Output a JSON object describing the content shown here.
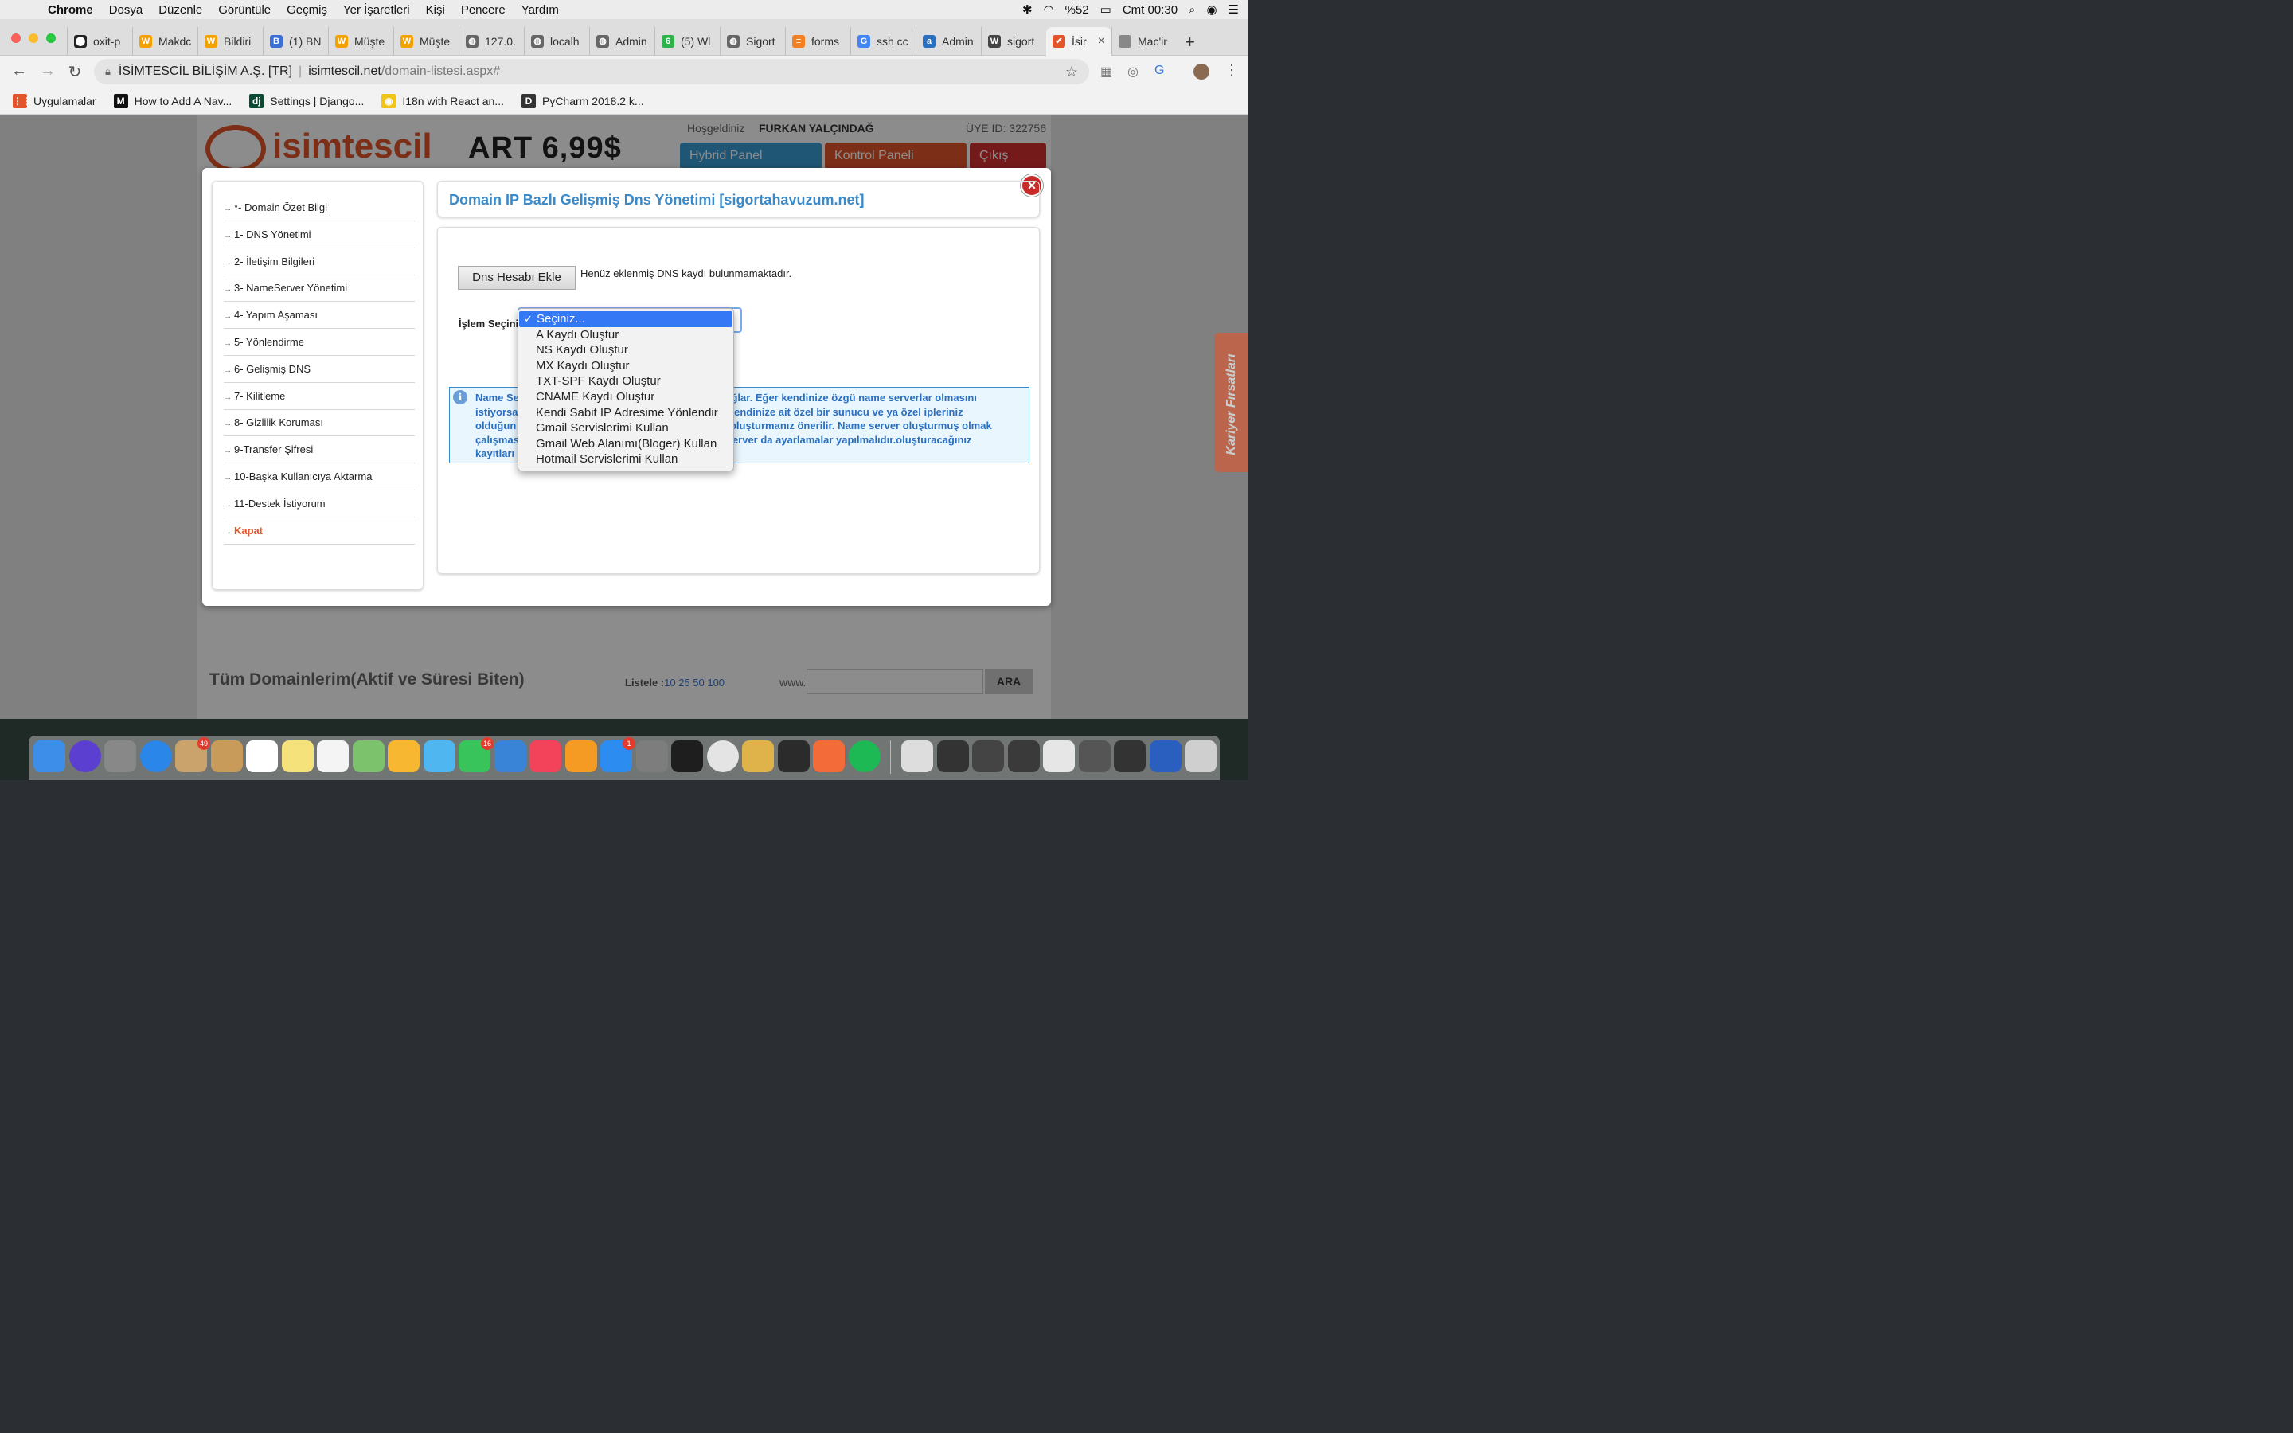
{
  "menubar": {
    "items": [
      "Chrome",
      "Dosya",
      "Düzenle",
      "Görüntüle",
      "Geçmiş",
      "Yer İşaretleri",
      "Kişi",
      "Pencere",
      "Yardım"
    ],
    "battery": "%52",
    "clock": "Cmt 00:30"
  },
  "tabs": [
    {
      "label": "oxit-p",
      "color": "#222222",
      "glyph": "⬤"
    },
    {
      "label": "Makdc",
      "color": "#f4a100",
      "glyph": "W"
    },
    {
      "label": "Bildiri",
      "color": "#f4a100",
      "glyph": "W"
    },
    {
      "label": "(1) BN",
      "color": "#3b6fd6",
      "glyph": "B"
    },
    {
      "label": "Müşte",
      "color": "#f4a100",
      "glyph": "W"
    },
    {
      "label": "Müşte",
      "color": "#f4a100",
      "glyph": "W"
    },
    {
      "label": "127.0.",
      "color": "#666666",
      "glyph": "◍"
    },
    {
      "label": "localh",
      "color": "#666666",
      "glyph": "◍"
    },
    {
      "label": "Admin",
      "color": "#666666",
      "glyph": "◍"
    },
    {
      "label": "(5) Wl",
      "color": "#2db34a",
      "glyph": "6"
    },
    {
      "label": "Sigort",
      "color": "#666666",
      "glyph": "◍"
    },
    {
      "label": "forms",
      "color": "#f48024",
      "glyph": "≡"
    },
    {
      "label": "ssh cc",
      "color": "#4285f4",
      "glyph": "G"
    },
    {
      "label": "Admin",
      "color": "#2a6fc0",
      "glyph": "a"
    },
    {
      "label": "sigort",
      "color": "#444444",
      "glyph": "W"
    },
    {
      "label": "İsir",
      "color": "#e2542a",
      "glyph": "✔",
      "active": true
    },
    {
      "label": "Mac'ir",
      "color": "#888888",
      "glyph": ""
    }
  ],
  "address": {
    "site_name": "İSİMTESCİL BİLİŞİM A.Ş. [TR]",
    "host": "isimtescil.net",
    "path": "/domain-listesi.aspx#"
  },
  "bookmarks": [
    {
      "label": "Uygulamalar",
      "glyph": "⋮⋮",
      "color": "#e2542a"
    },
    {
      "label": "How to Add A Nav...",
      "glyph": "M",
      "color": "#111111"
    },
    {
      "label": "Settings | Django...",
      "glyph": "dj",
      "color": "#0c4b33"
    },
    {
      "label": "I18n with React an...",
      "glyph": "◉",
      "color": "#f0c419"
    },
    {
      "label": "PyCharm 2018.2 k...",
      "glyph": "D",
      "color": "#333333"
    }
  ],
  "site": {
    "logo": "isimtescil",
    "promo": "ART 6,99$",
    "greeting": "Hoşgeldiniz",
    "user": "FURKAN YALÇINDAĞ",
    "member_id": "ÜYE ID: 322756",
    "header_buttons": [
      {
        "label": "Hybrid Panel",
        "color": "#3a9bd5"
      },
      {
        "label": "Kontrol Paneli",
        "color": "#e2542a"
      },
      {
        "label": "Çıkış",
        "color": "#d63031"
      }
    ],
    "all_domains": "Tüm Domainlerim(Aktif ve Süresi Biten)",
    "listele_label": "Listele :",
    "listele_values": "10 25 50 100",
    "www": "www.",
    "search_button": "ARA",
    "side_tab": "Kariyer Fırsatları"
  },
  "modal": {
    "title": "Domain IP Bazlı Gelişmiş Dns Yönetimi [sigortahavuzum.net]",
    "menu": [
      "*- Domain Özet Bilgi",
      "1- DNS Yönetimi",
      "2- İletişim Bilgileri",
      "3- NameServer Yönetimi",
      "4- Yapım Aşaması",
      "5- Yönlendirme",
      "6- Gelişmiş DNS",
      "7- Kilitleme",
      "8- Gizlilik Koruması",
      "9-Transfer Şifresi",
      "10-Başka Kullanıcıya Aktarma",
      "11-Destek İstiyorum",
      "Kapat"
    ],
    "add_button": "Dns Hesabı Ekle",
    "no_record": "Henüz eklenmiş DNS kaydı bulunmamaktadır.",
    "select_label": "İşlem Seçini",
    "info_lines": [
      "Name Se                                                                 ızı sağlar. Eğer kendinize özgü name serverlar olmasını",
      "istiyorsa                                                                    er, kendinize ait özel bir sunucu ve ya özel ipleriniz",
      "olduğun                                                                      er oluşturmanız önerilir. Name server oluşturmuş olmak",
      "çalışmas                                                                   ns server da ayarlamalar yapılmalıdır.oluşturacağınız",
      "kayıtları"
    ]
  },
  "dropdown": {
    "options": [
      "Seçiniz...",
      "A Kaydı Oluştur",
      "NS Kaydı Oluştur",
      "MX Kaydı Oluştur",
      "TXT-SPF Kaydı Oluştur",
      "CNAME Kaydı Oluştur",
      "Kendi Sabit IP Adresime Yönlendir",
      "Gmail Servislerimi Kullan",
      "Gmail Web Alanımı(Bloger) Kullan",
      "Hotmail Servislerimi Kullan"
    ],
    "selected_index": 0,
    "check_glyph": "✓"
  },
  "dock": {
    "icons": [
      {
        "name": "finder-icon",
        "color": "#3d8ee8"
      },
      {
        "name": "siri-icon",
        "color": "#5a3fd0"
      },
      {
        "name": "launchpad-icon",
        "color": "#888888"
      },
      {
        "name": "safari-icon",
        "color": "#2a86e8"
      },
      {
        "name": "mail-icon",
        "color": "#c9a36b",
        "badge": "49"
      },
      {
        "name": "contacts-icon",
        "color": "#c89b5a"
      },
      {
        "name": "calendar-icon",
        "color": "#ffffff"
      },
      {
        "name": "notes-icon",
        "color": "#f5e27a"
      },
      {
        "name": "reminders-icon",
        "color": "#f4f4f4"
      },
      {
        "name": "maps-icon",
        "color": "#7cc26c"
      },
      {
        "name": "photos-icon",
        "color": "#f7b731"
      },
      {
        "name": "messages-icon",
        "color": "#4fb6f0"
      },
      {
        "name": "facetime-icon",
        "color": "#39c45b",
        "badge": "16"
      },
      {
        "name": "keynote-icon",
        "color": "#3a84d8"
      },
      {
        "name": "music-icon",
        "color": "#f2435a"
      },
      {
        "name": "books-icon",
        "color": "#f59a23"
      },
      {
        "name": "appstore-icon",
        "color": "#2d8cf0",
        "badge": "1"
      },
      {
        "name": "system-preferences-icon",
        "color": "#7d7d7d"
      },
      {
        "name": "pycharm-icon",
        "color": "#1e1e1e"
      },
      {
        "name": "chrome-icon",
        "color": "#e4e4e4"
      },
      {
        "name": "archive-icon",
        "color": "#e0b24a"
      },
      {
        "name": "terminal-icon",
        "color": "#2b2b2b"
      },
      {
        "name": "pencil-app-icon",
        "color": "#f26b38"
      },
      {
        "name": "spotify-icon",
        "color": "#1db954"
      },
      {
        "name": "document-thumbnail-icon",
        "color": "#dddddd"
      },
      {
        "name": "window-thumbnail-icon",
        "color": "#333333"
      },
      {
        "name": "window-thumbnail-icon",
        "color": "#444444"
      },
      {
        "name": "window-thumbnail-icon",
        "color": "#3a3a3a"
      },
      {
        "name": "window-thumbnail-icon",
        "color": "#e6e6e6"
      },
      {
        "name": "window-thumbnail-icon",
        "color": "#555555"
      },
      {
        "name": "window-thumbnail-icon",
        "color": "#333333"
      },
      {
        "name": "window-thumbnail-icon",
        "color": "#2a5fc0"
      },
      {
        "name": "trash-icon",
        "color": "#cfcfcf"
      }
    ]
  }
}
